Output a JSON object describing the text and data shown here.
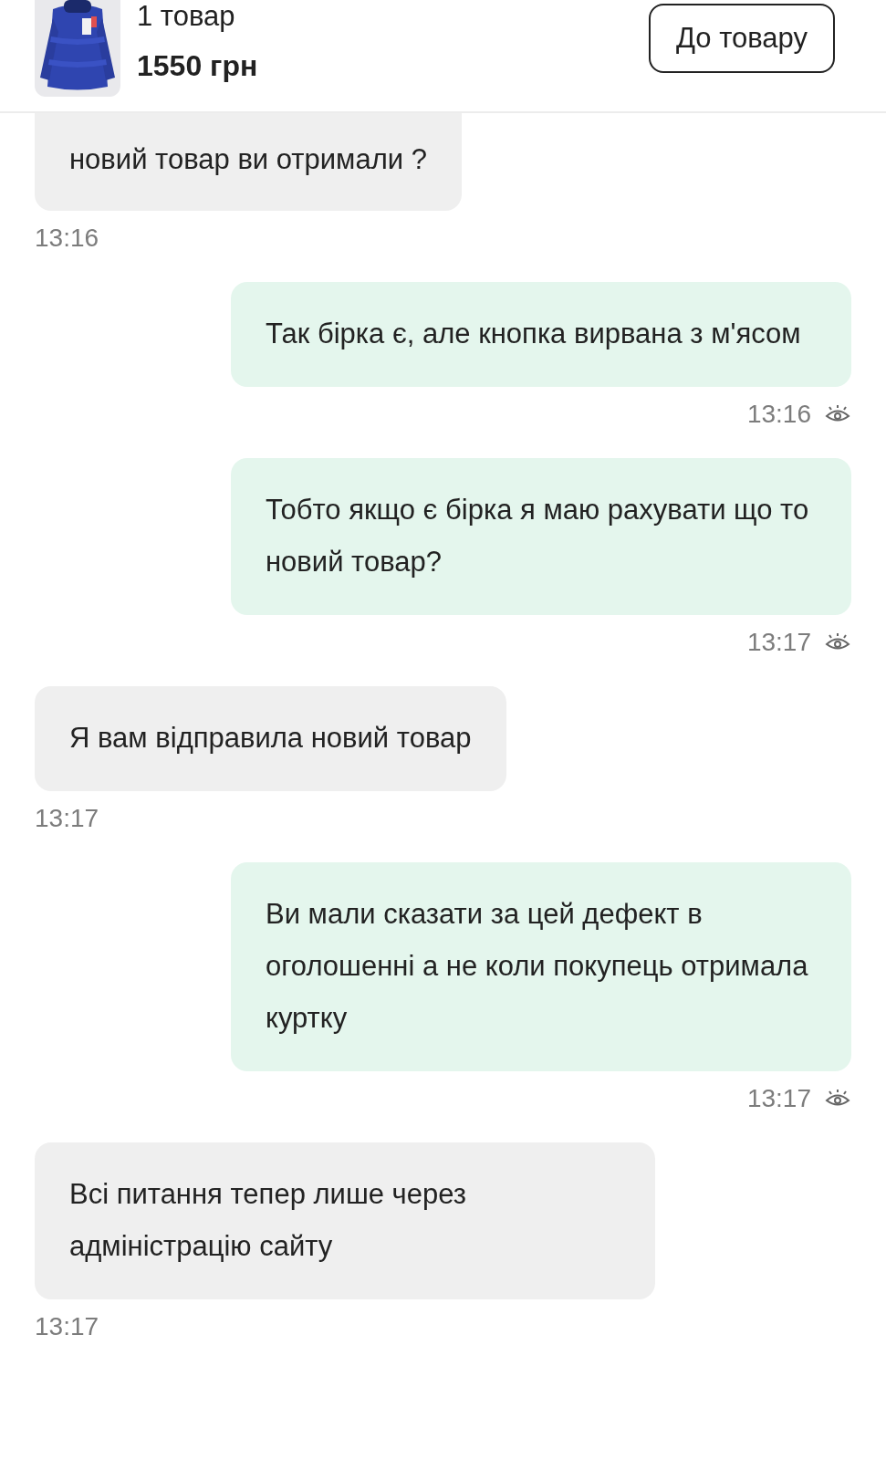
{
  "product": {
    "count": "1 товар",
    "price": "1550 грн",
    "button": "До товару"
  },
  "messages": [
    {
      "kind": "incoming",
      "text": "новий товар ви отримали ?",
      "time": "13:16"
    },
    {
      "kind": "outgoing",
      "text": "Так бірка є, але кнопка вирвана з м'ясом",
      "time": "13:16",
      "seen": true
    },
    {
      "kind": "outgoing",
      "text": "Тобто якщо є бірка я маю рахувати що то новий товар?",
      "time": "13:17",
      "seen": true
    },
    {
      "kind": "incoming",
      "text": "Я вам відправила новий товар",
      "time": "13:17"
    },
    {
      "kind": "outgoing",
      "text": "Ви мали сказати за цей дефект в оголошенні а не коли покупець отримала куртку",
      "time": "13:17",
      "seen": true
    },
    {
      "kind": "incoming",
      "text": "Всі питання тепер лише через адміністрацію сайту",
      "time": "13:17"
    }
  ]
}
